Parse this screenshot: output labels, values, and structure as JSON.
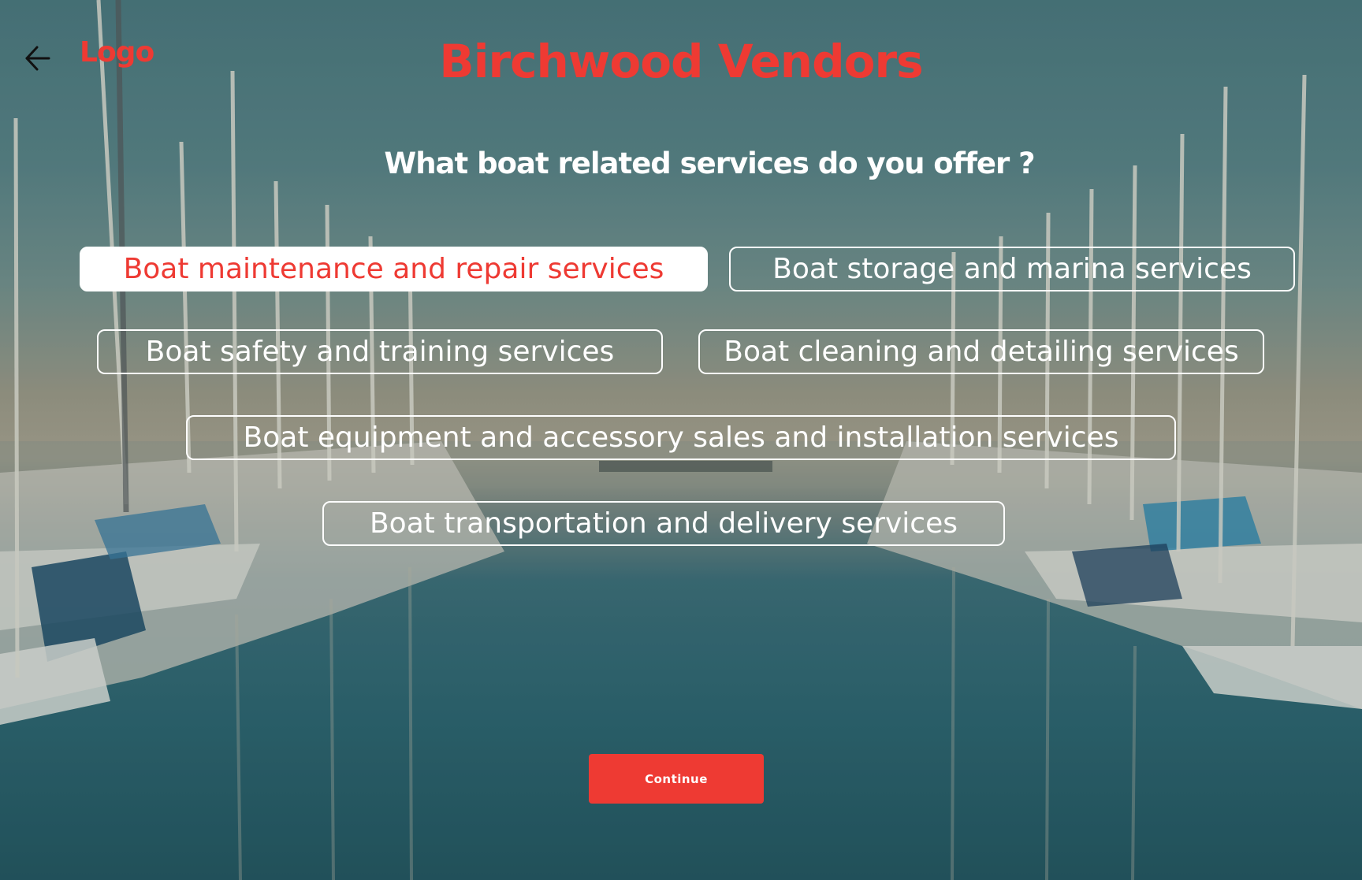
{
  "header": {
    "back_icon": "arrow-left-icon",
    "logo_text": "Logo",
    "title": "Birchwood Vendors"
  },
  "question": {
    "text": "What boat related services do you offer ?"
  },
  "services": [
    {
      "label": "Boat maintenance and repair services",
      "selected": true
    },
    {
      "label": "Boat storage and marina services",
      "selected": false
    },
    {
      "label": "Boat safety and training services",
      "selected": false
    },
    {
      "label": "Boat cleaning and detailing services",
      "selected": false
    },
    {
      "label": "Boat equipment and accessory sales and installation services",
      "selected": false
    },
    {
      "label": "Boat transportation and delivery services",
      "selected": false
    }
  ],
  "footer": {
    "continue_label": "Continue"
  },
  "colors": {
    "accent": "#ee3a33",
    "chip_border": "#ffffff",
    "selected_chip_bg": "#ffffff",
    "text_light": "#ffffff"
  }
}
